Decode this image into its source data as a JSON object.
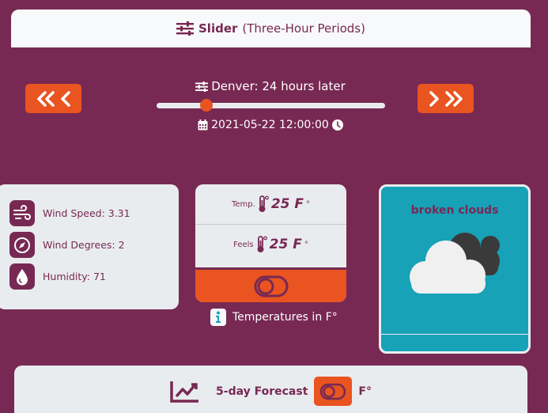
{
  "header": {
    "title_bold": "Slider",
    "title_rest": "(Three-Hour Periods)"
  },
  "slider": {
    "label": "Denver: 24 hours later",
    "value_fraction": 0.2,
    "datetime": "2021-05-22 12:00:00"
  },
  "nav": {
    "back_icons": [
      "double-chevron-left-icon",
      "chevron-left-icon"
    ],
    "forward_icons": [
      "chevron-right-icon",
      "double-chevron-right-icon"
    ]
  },
  "wind": {
    "speed_label": "Wind Speed: 3.31",
    "degrees_label": "Wind Degrees: 2",
    "humidity_label": "Humidity: 71"
  },
  "temps": {
    "temp_label": "Temp.",
    "temp_value": "25 F",
    "temp_unit": "°",
    "feels_label": "Feels",
    "feels_value": "25 F",
    "feels_unit": "°",
    "note": "Temperatures in F°"
  },
  "weather": {
    "description": "broken clouds"
  },
  "forecast": {
    "label": "5-day Forecast",
    "unit": "F°"
  },
  "colors": {
    "background": "#772953",
    "accent": "#e95420",
    "card": "#e9ecef",
    "weather": "#17a2b8"
  }
}
